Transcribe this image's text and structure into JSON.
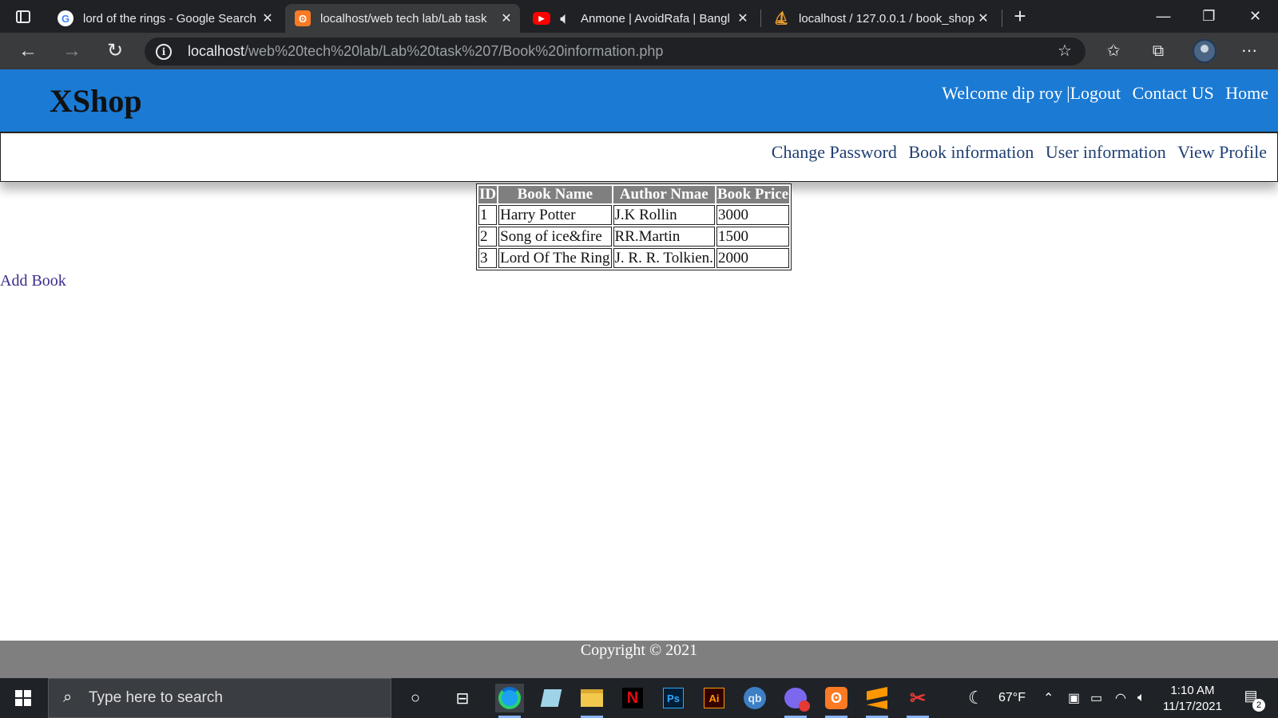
{
  "browser": {
    "tabs": [
      {
        "title": "lord of the rings - Google Search",
        "favicon": "google-icon"
      },
      {
        "title": "localhost/web tech lab/Lab task",
        "favicon": "xampp-icon",
        "active": true
      },
      {
        "title": "Anmone | AvoidRafa | Bangl",
        "favicon": "youtube-icon",
        "audio": "speaker-icon"
      },
      {
        "title": "localhost / 127.0.0.1 / book_shop",
        "favicon": "phpmyadmin-icon"
      }
    ],
    "url": {
      "host": "localhost",
      "path": "/web%20tech%20lab/Lab%20task%207/Book%20information.php"
    }
  },
  "site": {
    "logo": "XShop",
    "top_links": {
      "welcome": "Welcome dip roy",
      "pipe": "|",
      "logout": "Logout",
      "contact": "Contact US",
      "home": "Home"
    },
    "subnav": {
      "change_password": "Change Password",
      "book_information": "Book information",
      "user_information": "User information",
      "view_profile": "View Profile"
    },
    "table": {
      "headers": [
        "ID",
        "Book Name",
        "Author Nmae",
        "Book Price"
      ],
      "rows": [
        [
          "1",
          "Harry Potter",
          "J.K Rollin",
          "3000"
        ],
        [
          "2",
          "Song of ice&fire",
          "RR.Martin",
          "1500"
        ],
        [
          "3",
          "Lord Of The Ring",
          "J. R. R. Tolkien.",
          "2000"
        ]
      ]
    },
    "add_book": "Add Book",
    "footer": "Copyright © 2021"
  },
  "taskbar": {
    "search_placeholder": "Type here to search",
    "weather": "67°F",
    "time": "1:10 AM",
    "date": "11/17/2021",
    "notification_count": "2",
    "photoshop_label": "Ps",
    "illustrator_label": "Ai",
    "qbittorrent_label": "qb",
    "netflix_label": "N"
  },
  "colors": {
    "header_blue": "#1a7ad4",
    "table_header_gray": "#7f7f7f",
    "footer_gray": "#7f7f7f",
    "subnav_link": "#1f3f73"
  }
}
